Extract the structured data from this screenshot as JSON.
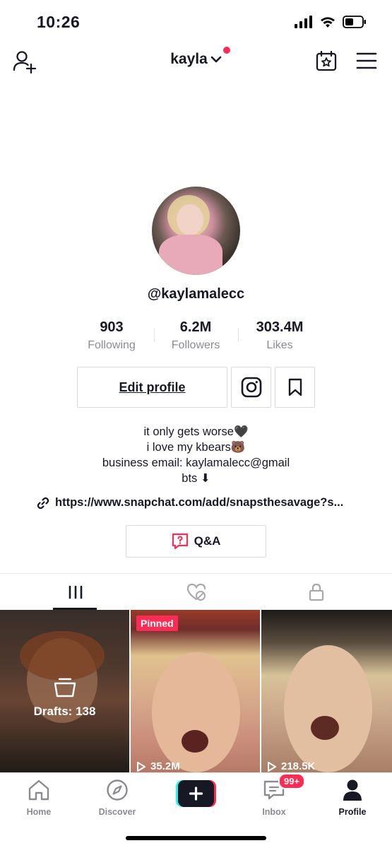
{
  "status_bar": {
    "time": "10:26"
  },
  "header": {
    "title": "kayla"
  },
  "profile": {
    "username": "@kaylamalecc",
    "stats": [
      {
        "value": "903",
        "label": "Following"
      },
      {
        "value": "6.2M",
        "label": "Followers"
      },
      {
        "value": "303.4M",
        "label": "Likes"
      }
    ],
    "edit_profile_label": "Edit profile",
    "bio": [
      "it only gets worse🖤",
      "i love my kbears🐻",
      "business email: kaylamalecc@gmail",
      "bts ⬇"
    ],
    "link": "https://www.snapchat.com/add/snapsthesavage?s...",
    "qa_label": "Q&A"
  },
  "grid": {
    "drafts_label": "Drafts: 138",
    "pinned_label": "Pinned",
    "video_views": [
      "35.2M",
      "218.5K"
    ]
  },
  "bottom_nav": {
    "home": "Home",
    "discover": "Discover",
    "inbox": "Inbox",
    "inbox_badge": "99+",
    "profile": "Profile"
  },
  "colors": {
    "accent": "#fe2c55",
    "text": "#161823",
    "muted": "#8a8b91"
  }
}
